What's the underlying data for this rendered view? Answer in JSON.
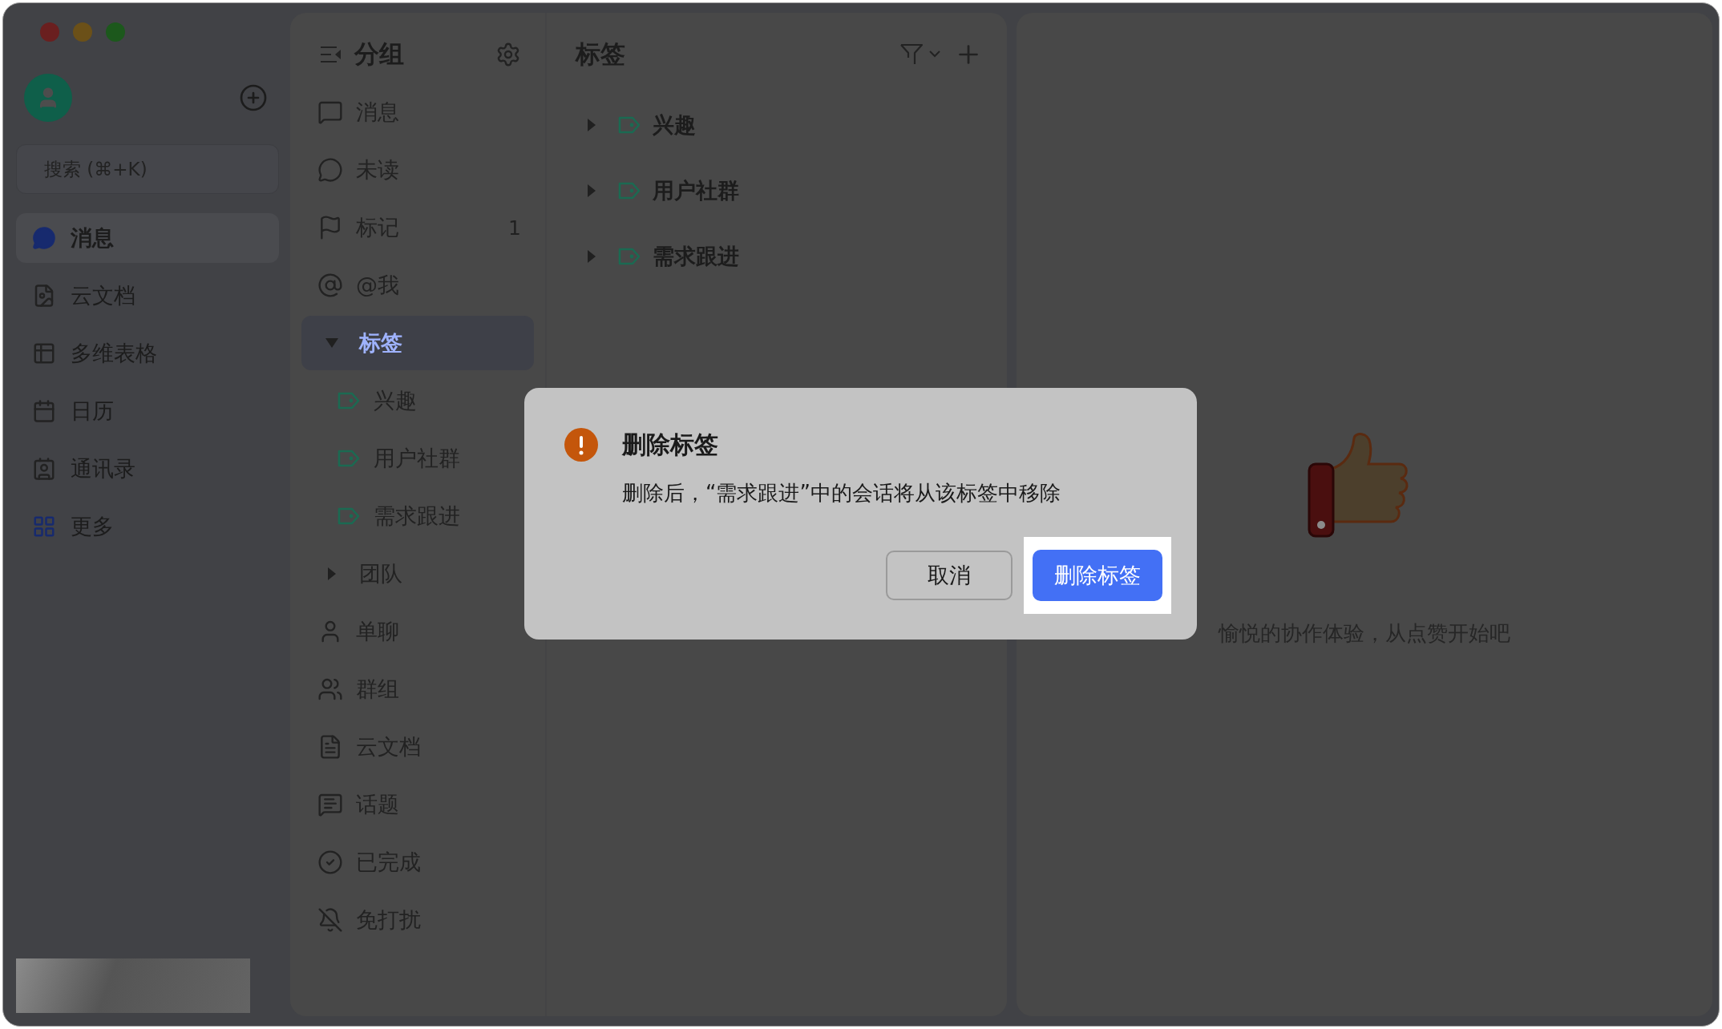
{
  "sidebar": {
    "search": {
      "placeholder": "搜索 (⌘+K)"
    },
    "items": [
      {
        "label": "消息",
        "selected": true
      },
      {
        "label": "云文档",
        "selected": false
      },
      {
        "label": "多维表格",
        "selected": false
      },
      {
        "label": "日历",
        "selected": false
      },
      {
        "label": "通讯录",
        "selected": false
      },
      {
        "label": "更多",
        "selected": false
      }
    ]
  },
  "groups_panel": {
    "title": "分组",
    "items": [
      {
        "kind": "item",
        "label": "消息",
        "selected": false
      },
      {
        "kind": "item",
        "label": "未读",
        "selected": false
      },
      {
        "kind": "item",
        "label": "标记",
        "count": "1",
        "selected": false
      },
      {
        "kind": "item",
        "label": "@我",
        "selected": false
      },
      {
        "kind": "folder",
        "label": "标签",
        "expanded": true,
        "selected": true,
        "children": [
          {
            "label": "兴趣",
            "selected": false
          },
          {
            "label": "用户社群",
            "selected": false
          },
          {
            "label": "需求跟进",
            "selected": false
          }
        ]
      },
      {
        "kind": "folder",
        "label": "团队",
        "expanded": false,
        "selected": false
      },
      {
        "kind": "item",
        "label": "单聊",
        "selected": false
      },
      {
        "kind": "item",
        "label": "群组",
        "selected": false
      },
      {
        "kind": "item",
        "label": "云文档",
        "selected": false
      },
      {
        "kind": "item",
        "label": "话题",
        "selected": false
      },
      {
        "kind": "item",
        "label": "已完成",
        "selected": false
      },
      {
        "kind": "item",
        "label": "免打扰",
        "selected": false
      }
    ]
  },
  "tags_panel": {
    "title": "标签",
    "tags": [
      {
        "label": "兴趣",
        "expanded": false
      },
      {
        "label": "用户社群",
        "expanded": false
      },
      {
        "label": "需求跟进",
        "expanded": false
      }
    ]
  },
  "empty_state": {
    "text": "愉悦的协作体验，从点赞开始吧"
  },
  "dialog": {
    "title": "删除标签",
    "message": "删除后，“需求跟进”中的会话将从该标签中移除",
    "buttons": [
      {
        "label": "取消",
        "kind": "secondary"
      },
      {
        "label": "删除标签",
        "kind": "primary"
      }
    ]
  }
}
